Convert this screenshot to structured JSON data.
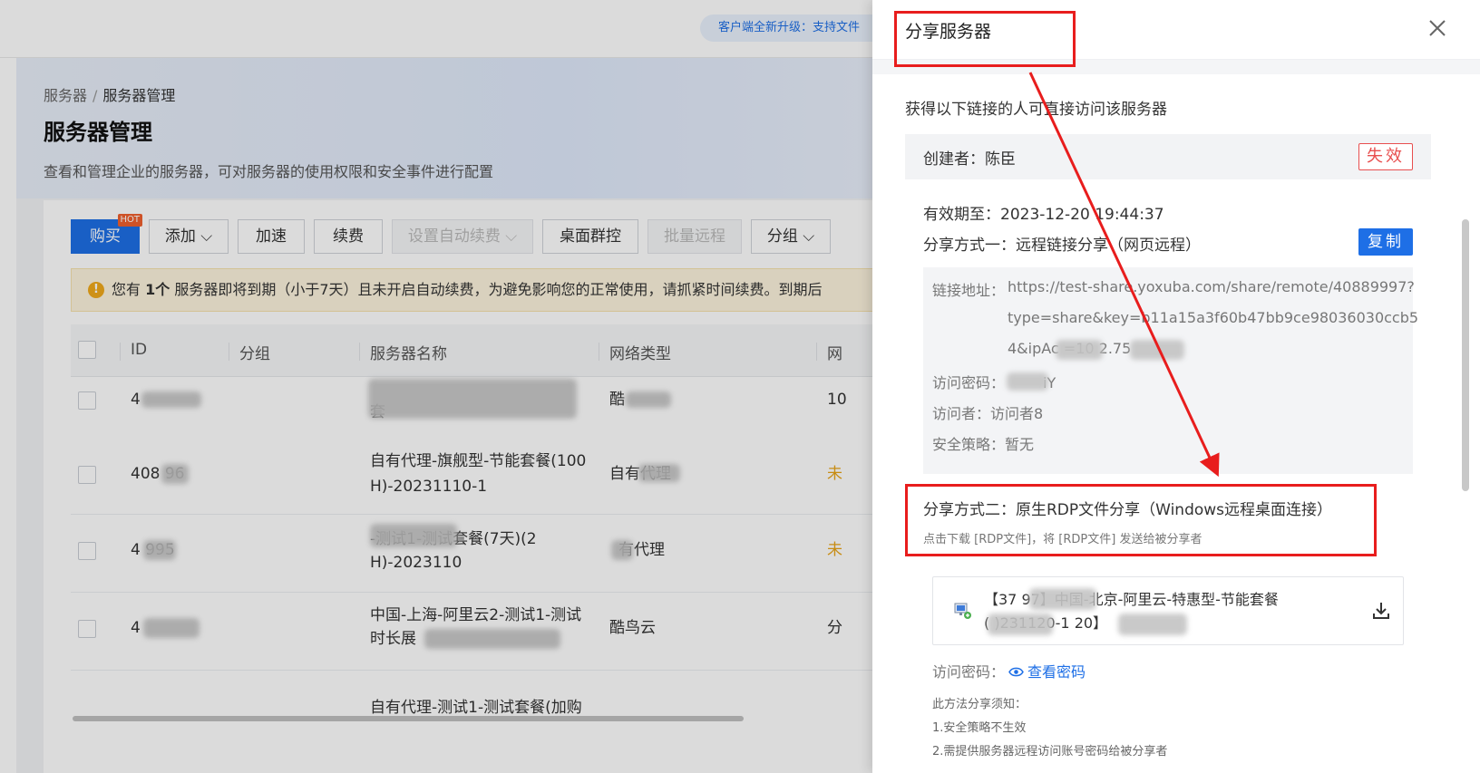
{
  "background": {
    "notice": "客户端全新升级：支持文件",
    "breadcrumb": {
      "parent": "服务器",
      "separator": "/",
      "current": "服务器管理"
    },
    "page_title": "服务器管理",
    "page_desc": "查看和管理企业的服务器，可对服务器的使用权限和安全事件进行配置",
    "toolbar": {
      "buy": "购买",
      "hot": "HOT",
      "add": "添加",
      "accelerate": "加速",
      "renew": "续费",
      "auto_renew": "设置自动续费",
      "desktop_control": "桌面群控",
      "batch_remote": "批量远程",
      "group": "分组"
    },
    "warning": {
      "prefix": "您有",
      "count": "1个",
      "text": "服务器即将到期（小于7天）且未开启自动续费，为避免影响您的正常使用，请抓紧时间续费。到期后"
    },
    "table": {
      "headers": [
        "ID",
        "分组",
        "服务器名称",
        "网络类型",
        "网"
      ],
      "rows": [
        {
          "id": "4",
          "name_line1": "",
          "name_line2": "套",
          "network": "酷",
          "extra": "10"
        },
        {
          "id": "408  96",
          "name_line1": "自有代理-旗舰型-节能套餐(100",
          "name_line2": "H)-20231110-1",
          "network": "自有代理",
          "extra": "未"
        },
        {
          "id": "4  995",
          "name_line1": "  -测试1-测试套餐(7天)(2",
          "name_line2": "H)-2023110",
          "network": "有代理",
          "extra": "未"
        },
        {
          "id": "4",
          "name_line1": "中国-上海-阿里云2-测试1-测试",
          "name_line2": "时长展",
          "network": "酷鸟云",
          "extra": "分"
        },
        {
          "id": "",
          "name_line1": "自有代理-测试1-测试套餐(加购",
          "name_line2": "",
          "network": "",
          "extra": ""
        }
      ]
    }
  },
  "drawer": {
    "title": "分享服务器",
    "subtitle": "获得以下链接的人可直接访问该服务器",
    "creator_label": "创建者：陈臣",
    "status_tag": "失效",
    "expiry": "有效期至：2023-12-20 19:44:37",
    "method1": "分享方式一：远程链接分享（网页远程）",
    "copy": "复制",
    "link_label": "链接地址：",
    "link_line1": "https://test-share.yoxuba.com/share/remote/40889997?",
    "link_line2": "type=share&key=b11a15a3f60b47bb9ce98036030ccb5",
    "link_line3": "4&ipAc        =10         2.75",
    "pwd_label": "访问密码：",
    "pwd_value": "iY",
    "visitor_label": "访问者：",
    "visitor_value": "访问者8",
    "policy_label": "安全策略：",
    "policy_value": "暂无",
    "method2": "分享方式二：原生RDP文件分享（Windows远程桌面连接）",
    "method2_sub": "点击下载 [RDP文件]，将 [RDP文件] 发送给被分享者",
    "rdp_line1": "【37         97】中国-北京-阿里云-特惠型-节能套餐",
    "rdp_line2": "(        )231120-1             20】",
    "rdp_pwd_label": "访问密码：",
    "view_pwd": "查看密码",
    "notes": [
      "此方法分享须知：",
      "1.安全策略不生效",
      "2.需提供服务器远程访问账号密码给被分享者"
    ]
  },
  "colors": {
    "primary": "#1e6fe6",
    "danger": "#e84f4f",
    "annotation": "#e81d1d",
    "warning": "#f0a91b"
  }
}
